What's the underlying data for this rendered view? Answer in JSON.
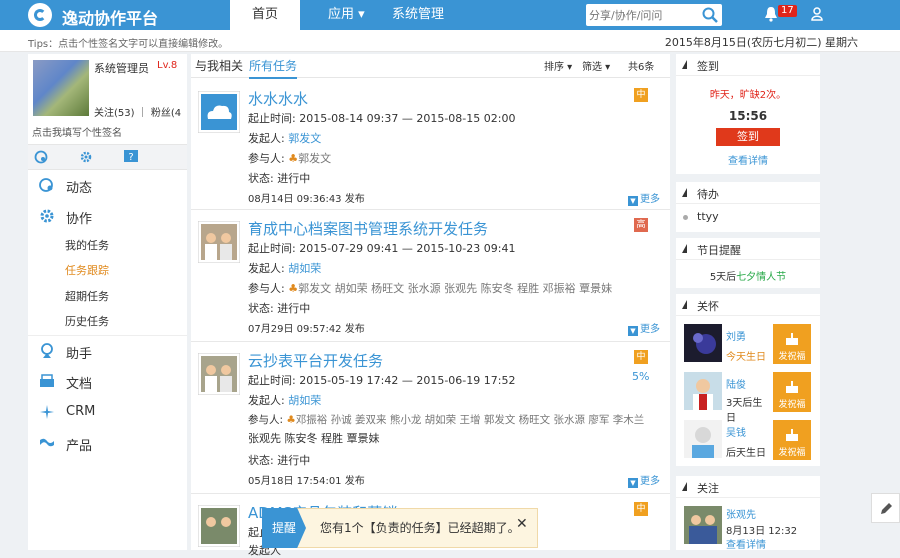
{
  "app": {
    "title": "逸动协作平台"
  },
  "nav": {
    "home": "首页",
    "apps": "应用 ▾",
    "system": "系统管理"
  },
  "search": {
    "placeholder": "分享/协作/问问"
  },
  "notifications": {
    "count": "17"
  },
  "tip": "Tips：点击个性签名文字可以直接编辑修改。",
  "date": "2015年8月15日(农历七月初二) 星期六",
  "profile": {
    "name": "系统管理员",
    "level": "Lv.8",
    "follow": "关注(53) ｜ 粉丝(4",
    "signature": "点击我填写个性签名"
  },
  "menu": {
    "dynamic": "动态",
    "collab": "协作",
    "sub": [
      "我的任务",
      "任务跟踪",
      "超期任务",
      "历史任务"
    ],
    "assistant": "助手",
    "docs": "文档",
    "crm": "CRM",
    "product": "产品"
  },
  "tabs": {
    "related": "与我相关",
    "all": "所有任务",
    "sort": "排序 ▾",
    "filter": "筛选 ▾",
    "count": "共6条"
  },
  "tasks": [
    {
      "title": "水水水水",
      "priority": "中",
      "priority_color": "#f0a020",
      "time": "起止时间: 2015-08-14 09:37 — 2015-08-15 02:00",
      "initiator_label": "发起人:",
      "initiator": "郭发文",
      "participant_label": "参与人:",
      "participants": "郭发文",
      "status": "状态: 进行中",
      "posted": "08月14日 09:36:43 发布",
      "more": "更多"
    },
    {
      "title": "育成中心档案图书管理系统开发任务",
      "priority": "高",
      "priority_color": "#e0694f",
      "time": "起止时间: 2015-07-29 09:41 — 2015-10-23 09:41",
      "initiator_label": "发起人:",
      "initiator": "胡如荣",
      "participant_label": "参与人:",
      "participants": "郭发文 胡如荣 杨旺文 张水源 张观先 陈安冬 程胜 邓振裕 覃景妹",
      "status": "状态: 进行中",
      "posted": "07月29日 09:57:42 发布",
      "more": "更多"
    },
    {
      "title": "云抄表平台开发任务",
      "priority": "中",
      "priority_color": "#f0a020",
      "progress": "5%",
      "time": "起止时间: 2015-05-19 17:42 — 2015-06-19 17:52",
      "initiator_label": "发起人:",
      "initiator": "胡如荣",
      "participant_label": "参与人:",
      "participants": "邓振裕 孙诚 姜双来 熊小龙 胡如荣 王增 郭发文 杨旺文 张水源 廖军 李木兰",
      "participants2": "张观先 陈安冬 程胜 覃景妹",
      "status": "状态: 进行中",
      "posted": "05月18日 17:54:01 发布",
      "more": "更多"
    },
    {
      "title": "ADMS产品包装和营销",
      "priority": "中",
      "priority_color": "#f0a020",
      "time": "起止",
      "initiator_label": "发起人"
    }
  ],
  "signin": {
    "title": "签到",
    "text": "昨天，旷缺2次。",
    "time": "15:56",
    "button": "签到",
    "details": "查看详情"
  },
  "todo": {
    "title": "待办",
    "item": "ttyy"
  },
  "holiday": {
    "title": "节日提醒",
    "prefix": "5天后",
    "name": "七夕情人节"
  },
  "care": {
    "title": "关怀",
    "people": [
      {
        "name": "刘勇",
        "note": "今天生日",
        "gift": "发祝福"
      },
      {
        "name": "陆俊",
        "note": "3天后生日",
        "gift": "发祝福"
      },
      {
        "name": "吴钱",
        "note": "后天生日",
        "gift": "发祝福"
      }
    ]
  },
  "attention": {
    "title": "关注",
    "name": "张观先",
    "time": "8月13日 12:32",
    "details": "查看详情"
  },
  "toast": {
    "tag": "提醒",
    "message": "您有1个【负责的任务】已经超期了。",
    "close": "✕"
  }
}
